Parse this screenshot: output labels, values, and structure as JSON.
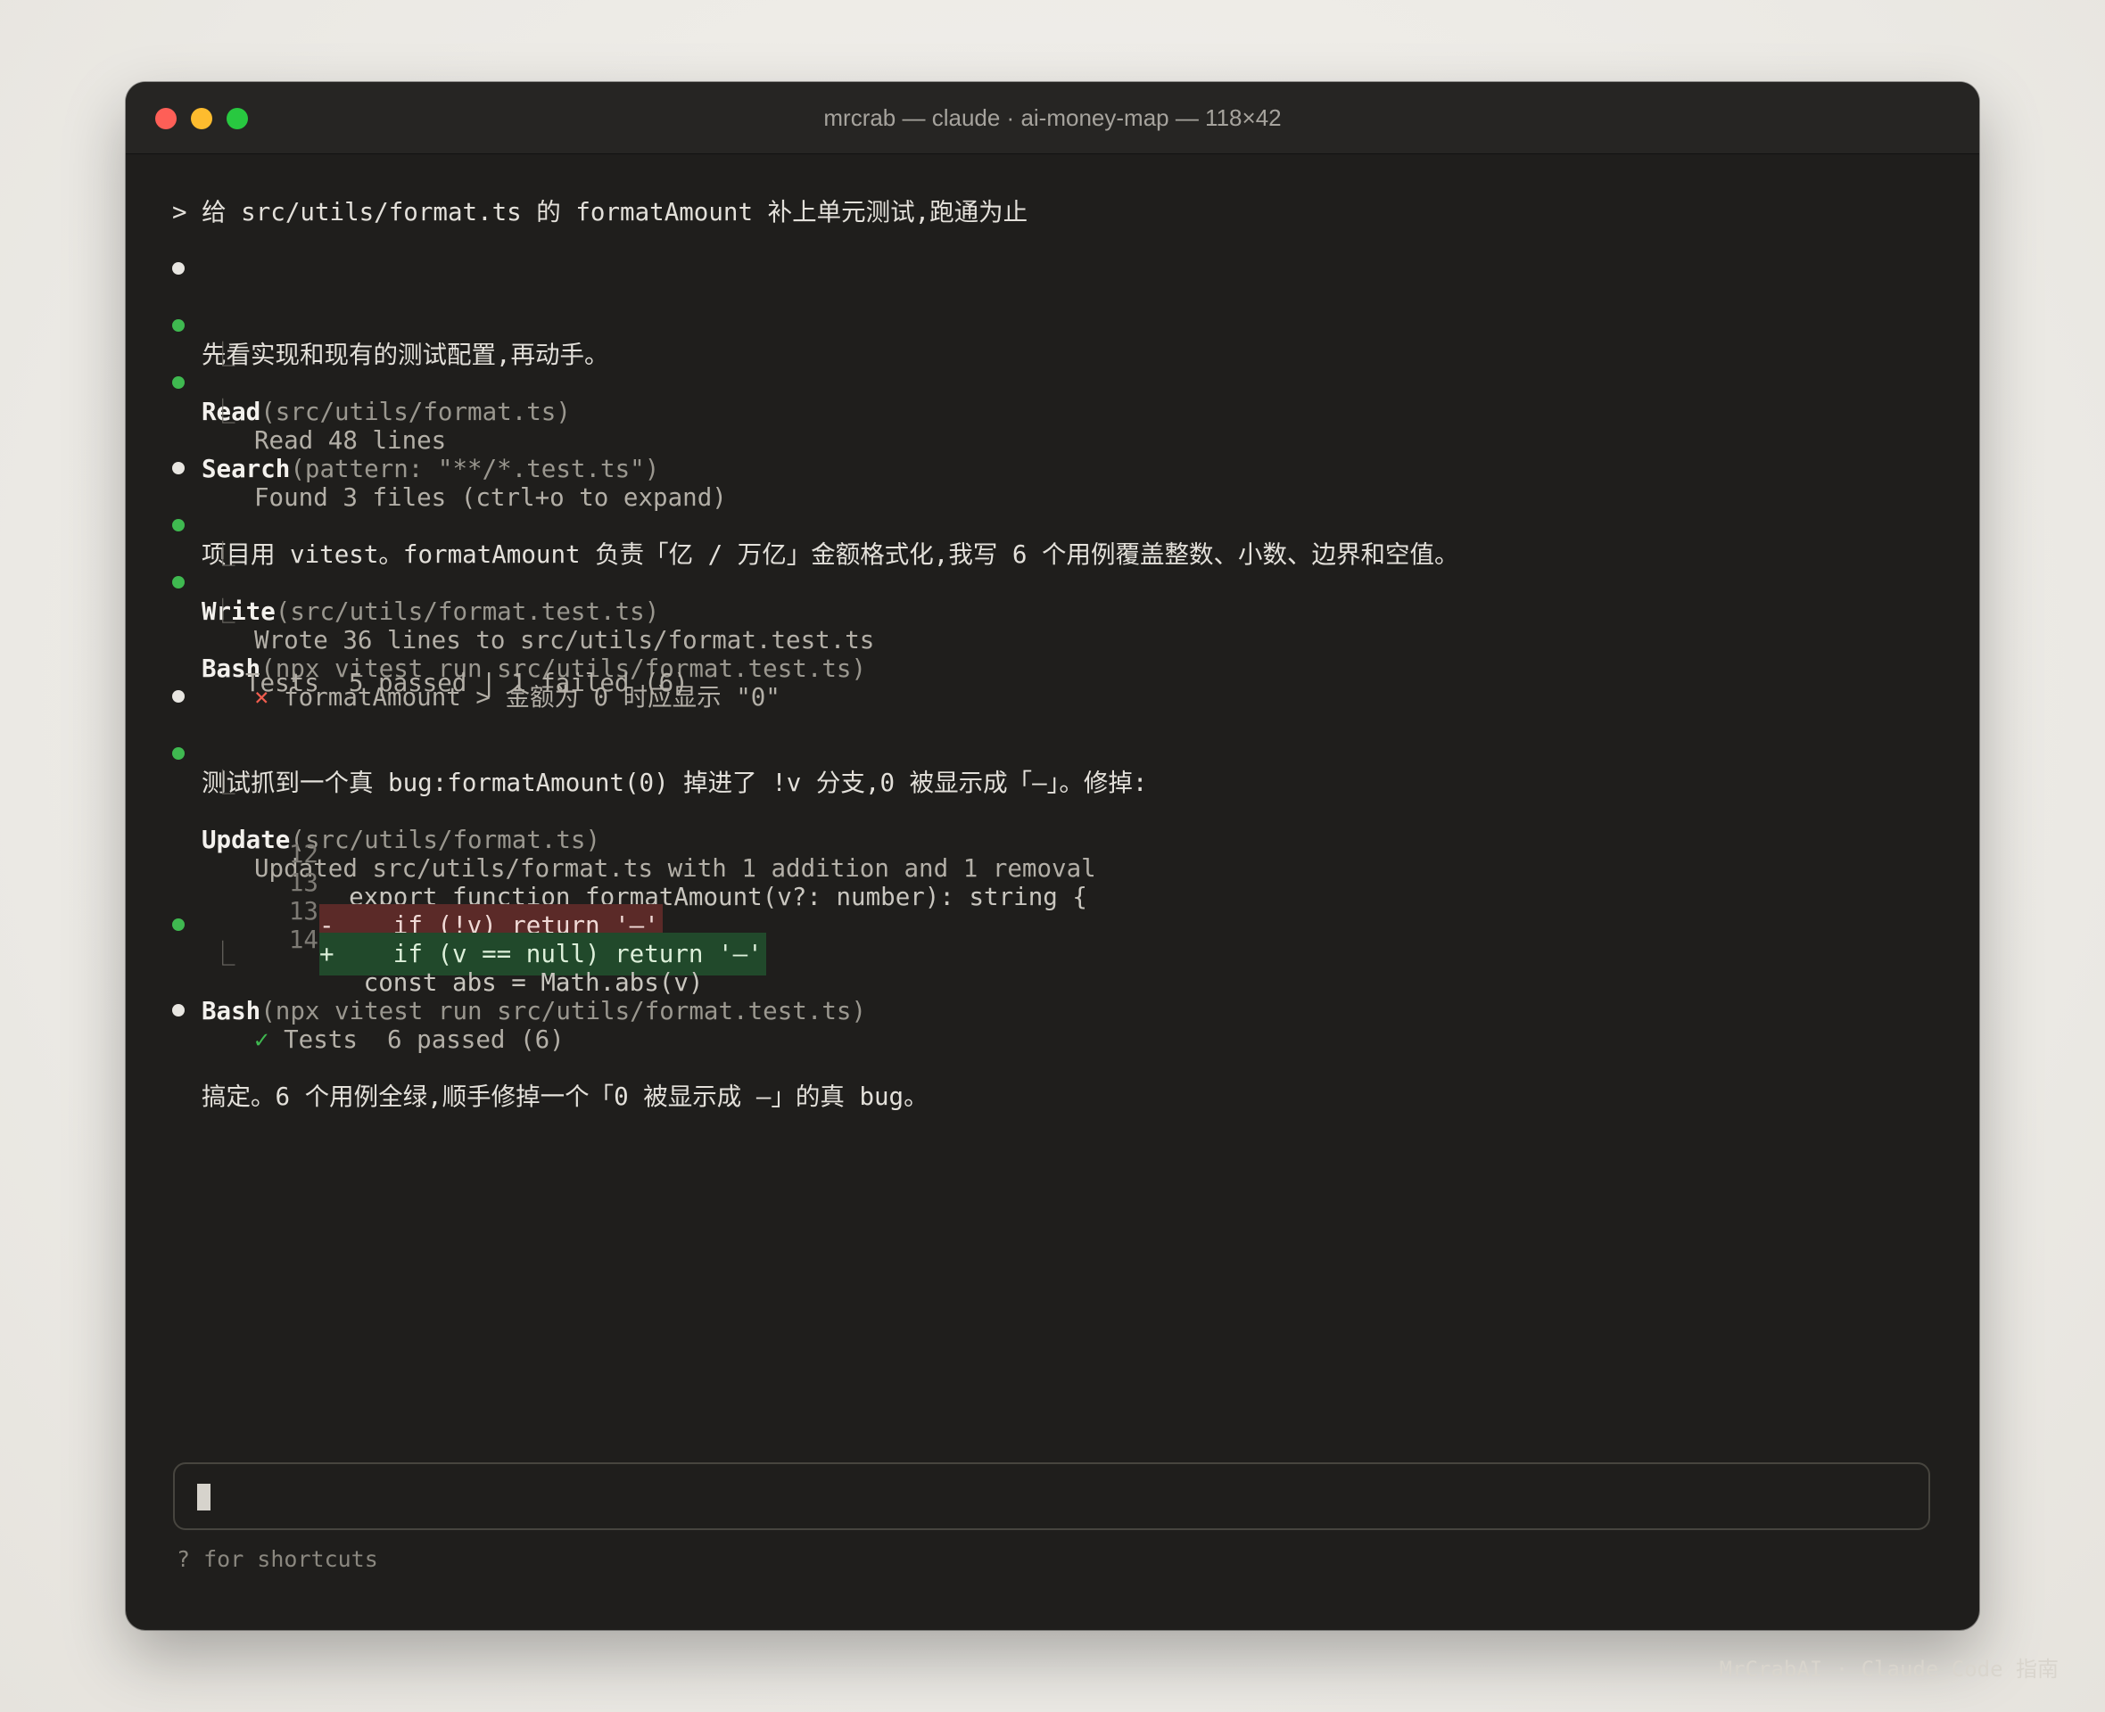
{
  "window": {
    "title": "mrcrab — claude · ai-money-map — 118×42"
  },
  "prompt": "> 给 src/utils/format.ts 的 formatAmount 补上单元测试,跑通为止",
  "messages": {
    "m1": "先看实现和现有的测试配置,再动手。",
    "m2": "项目用 vitest。formatAmount 负责「亿 / 万亿」金额格式化,我写 6 个用例覆盖整数、小数、边界和空值。",
    "m3": "测试抓到一个真 bug:formatAmount(0) 掉进了 !v 分支,0 被显示成「—」。修掉:",
    "m4": "搞定。6 个用例全绿,顺手修掉一个「0 被显示成 —」的真 bug。"
  },
  "tools": {
    "read": {
      "name": "Read",
      "arg": "(src/utils/format.ts)",
      "result": "Read 48 lines"
    },
    "search": {
      "name": "Search",
      "arg": "(pattern: \"**/*.test.ts\")",
      "result": "Found 3 files (ctrl+o to expand)"
    },
    "write": {
      "name": "Write",
      "arg": "(src/utils/format.test.ts)",
      "result": "Wrote 36 lines to src/utils/format.test.ts"
    },
    "bash1": {
      "name": "Bash",
      "arg": "(npx vitest run src/utils/format.test.ts)",
      "fail_mark": "×",
      "fail_text": "formatAmount > 金额为 0 时应显示 \"0\"",
      "summary": "Tests  5 passed | 1 failed (6)"
    },
    "update": {
      "name": "Update",
      "arg": "(src/utils/format.ts)",
      "result": "Updated src/utils/format.ts with 1 addition and 1 removal",
      "diff": [
        {
          "no": "12",
          "kind": "context",
          "text": "  export function formatAmount(v?: number): string {"
        },
        {
          "no": "13",
          "kind": "removed",
          "text": "-    if (!v) return '—'"
        },
        {
          "no": "13",
          "kind": "added",
          "text": "+    if (v == null) return '—'"
        },
        {
          "no": "14",
          "kind": "context",
          "text": "   const abs = Math.abs(v)"
        }
      ]
    },
    "bash2": {
      "name": "Bash",
      "arg": "(npx vitest run src/utils/format.test.ts)",
      "check_mark": "✓",
      "result": "Tests  6 passed (6)"
    }
  },
  "branch_glyph": "⎿",
  "footer": {
    "hint": "? for shortcuts"
  },
  "watermark": "MrCrabAI · Claude Code 指南",
  "colors": {
    "background": "#ebe9e4",
    "terminal_bg": "#1f1e1c",
    "success_dot": "#3fb950",
    "error_mark": "#f05d4e",
    "diff_removed_bg": "#5b2a28",
    "diff_added_bg": "#21492b"
  }
}
